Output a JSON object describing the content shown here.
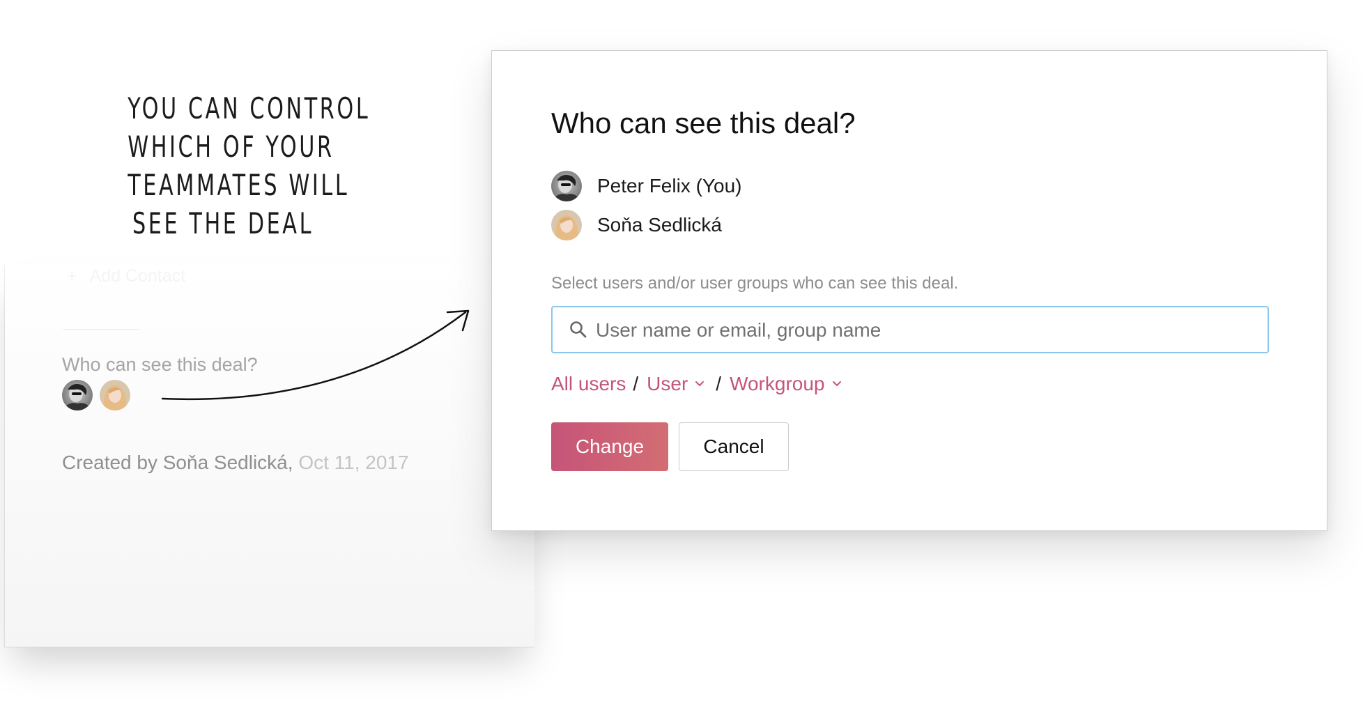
{
  "annotation": {
    "lines": [
      "YOU CAN CONTROL",
      "WHICH OF YOUR",
      "TEAMMATES WILL",
      "SEE THE DEAL"
    ]
  },
  "background_panel": {
    "ghost_add_label": "Add Contact",
    "ghost_add_icon": "+",
    "visibility_label": "Who can see this deal?",
    "created_prefix": "Created by Soňa Sedlická,",
    "created_date": "Oct 11, 2017"
  },
  "modal": {
    "title": "Who can see this deal?",
    "users": [
      {
        "name": "Peter Felix (You)",
        "avatar": "avatar-peter"
      },
      {
        "name": "Soňa Sedlická",
        "avatar": "avatar-sona"
      }
    ],
    "help_text": "Select users and/or user groups who can see this deal.",
    "search": {
      "placeholder": "User name or email, group name",
      "value": "",
      "icon": "search-icon"
    },
    "filters": {
      "all_users": "All users",
      "user": "User",
      "workgroup": "Workgroup",
      "separator": "/"
    },
    "buttons": {
      "change": "Change",
      "cancel": "Cancel"
    }
  },
  "colors": {
    "accent": "#c65478",
    "accent_end": "#d36d74",
    "input_focus": "#8cc6ea",
    "muted_text": "#8d8d8d"
  }
}
